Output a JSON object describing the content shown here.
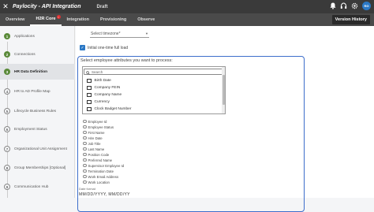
{
  "topbar": {
    "logo": "Paylocity - API Integration",
    "status": "Draft",
    "avatar_initials": "RG",
    "icons": [
      "bell-icon",
      "headset-icon",
      "gear-icon"
    ]
  },
  "nav": {
    "tabs": [
      {
        "label": "Overview",
        "active": false
      },
      {
        "label": "H2R Core",
        "active": true,
        "badge": "!"
      },
      {
        "label": "Integration",
        "active": false
      },
      {
        "label": "Provisioning",
        "active": false
      },
      {
        "label": "Observe",
        "active": false
      }
    ],
    "version_history": "Version History"
  },
  "steps": [
    {
      "num": "1",
      "label": "Applications",
      "state": "done"
    },
    {
      "num": "2",
      "label": "Connections",
      "state": "done"
    },
    {
      "num": "3",
      "label": "HR Data Definition",
      "state": "done"
    },
    {
      "num": "4",
      "label": "HR to AD Profile Map",
      "state": "pending"
    },
    {
      "num": "5",
      "label": "Lifecycle Business Rules",
      "state": "pending"
    },
    {
      "num": "6",
      "label": "Employment Status",
      "state": "pending"
    },
    {
      "num": "7",
      "label": "Organizational Unit Assignment",
      "state": "pending"
    },
    {
      "num": "8",
      "label": "Group Memberships [Optional]",
      "state": "pending"
    },
    {
      "num": "9",
      "label": "Communication Hub",
      "state": "pending"
    }
  ],
  "form": {
    "timezone_placeholder": "Select timezone*",
    "initial_load_label": "Initial one-time full load",
    "attributes_title": "Select employee attributes you want to process:",
    "search_placeholder": "Search",
    "checkbox_items": [
      "Birth Date",
      "Company FEIN",
      "Company Name",
      "Currency",
      "Clock Badget Number"
    ],
    "radio_items": [
      "Employee Id",
      "Employee Status",
      "First Name",
      "Hire Date",
      "Job Title",
      "Last Name",
      "Position Code",
      "Preferred Name",
      "Supervisor Employee Id",
      "Termination Date",
      "Work Email Address",
      "Work Location"
    ],
    "date_format_label": "Date format",
    "date_format_value": "MM/DD/YYYY, MM/DD/YY"
  }
}
